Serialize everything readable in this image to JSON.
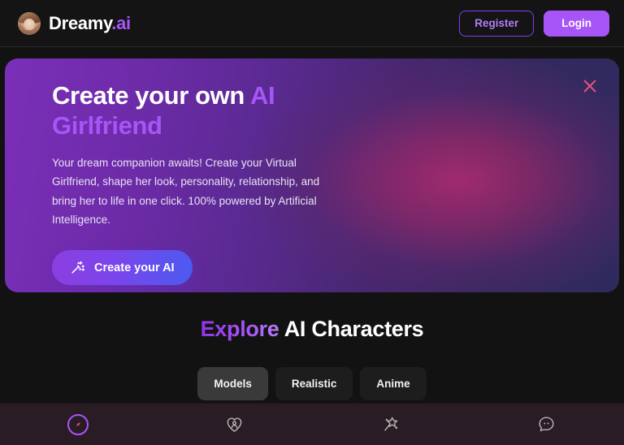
{
  "header": {
    "logo_icon": "avatar-photo",
    "brand_name": "Dreamy",
    "brand_suffix": ".ai",
    "register_label": "Register",
    "login_label": "Login",
    "accent_color": "#a855f7",
    "background": "#141414"
  },
  "hero": {
    "title_part1": "Create your own ",
    "title_accent1": "AI",
    "title_accent2": "Girlfriend",
    "description": "Your dream companion awaits! Create your Virtual Girlfriend, shape her look, personality, relationship, and bring her to life in one click. 100% powered by Artificial Intelligence.",
    "cta_label": "Create your AI",
    "cta_icon": "magic-wand-icon",
    "close_icon": "close-icon",
    "close_color": "#e8547f",
    "gradient_from": "#7a2fb8",
    "gradient_glow": "#a02a6e",
    "gradient_to": "#2e2a5e"
  },
  "explore": {
    "title_accent": "Explore",
    "title_rest": " AI Characters",
    "tabs": [
      {
        "label": "Models",
        "active": true
      },
      {
        "label": "Realistic",
        "active": false
      },
      {
        "label": "Anime",
        "active": false
      }
    ]
  },
  "bottomnav": {
    "background": "#2a1c25",
    "items": [
      {
        "name": "explore",
        "icon": "compass-icon",
        "active": true
      },
      {
        "name": "my-ai",
        "icon": "heart-person-icon",
        "active": false
      },
      {
        "name": "create",
        "icon": "magic-wand-star-icon",
        "active": false
      },
      {
        "name": "chat",
        "icon": "chat-bubble-icon",
        "active": false
      }
    ]
  }
}
